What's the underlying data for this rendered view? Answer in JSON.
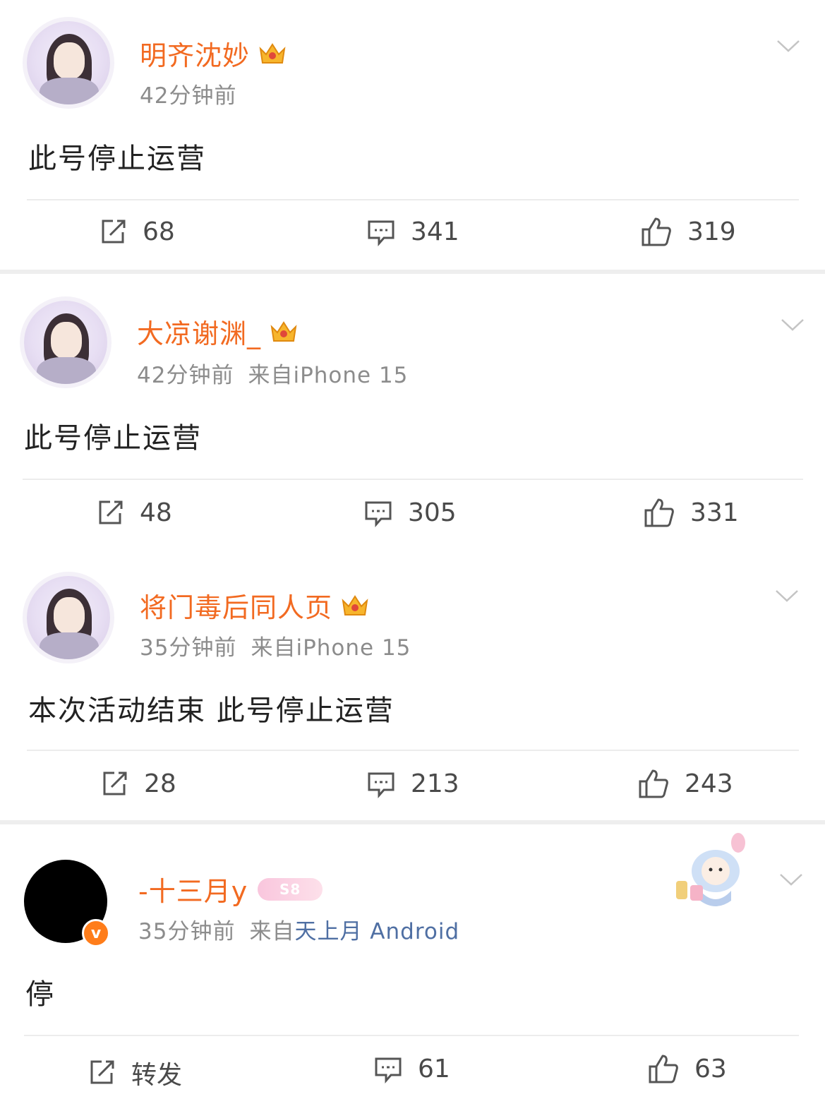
{
  "posts": [
    {
      "username": "明齐沈妙",
      "time": "42分钟前",
      "source_prefix": "",
      "source": "",
      "content": "此号停止运营",
      "repost_label": "68",
      "comment_count": "341",
      "like_count": "319"
    },
    {
      "username": "大凉谢渊_",
      "time": "42分钟前",
      "source_prefix": "来自",
      "source": "iPhone 15",
      "content": "此号停止运营",
      "repost_label": "48",
      "comment_count": "305",
      "like_count": "331"
    },
    {
      "username": "将门毒后同人页",
      "time": "35分钟前",
      "source_prefix": "来自",
      "source": "iPhone 15",
      "content": "本次活动结束 此号停止运营",
      "repost_label": "28",
      "comment_count": "213",
      "like_count": "243"
    },
    {
      "username": "-十三月y",
      "badge": "S8",
      "time": "35分钟前",
      "source_prefix": "来自",
      "source": "天上月 Android",
      "content": "停",
      "repost_label": "转发",
      "comment_count": "61",
      "like_count": "63"
    }
  ],
  "icons": {
    "repost": "repost-icon",
    "comment": "comment-icon",
    "like": "thumbs-up-icon",
    "menu": "chevron-down-icon",
    "crown": "crown-icon",
    "verified": "verified-badge-icon"
  },
  "colors": {
    "username": "#f26a21",
    "meta": "#8c8c8c",
    "source_link": "#4f6fa3",
    "verified_badge": "#ff7d1a"
  }
}
